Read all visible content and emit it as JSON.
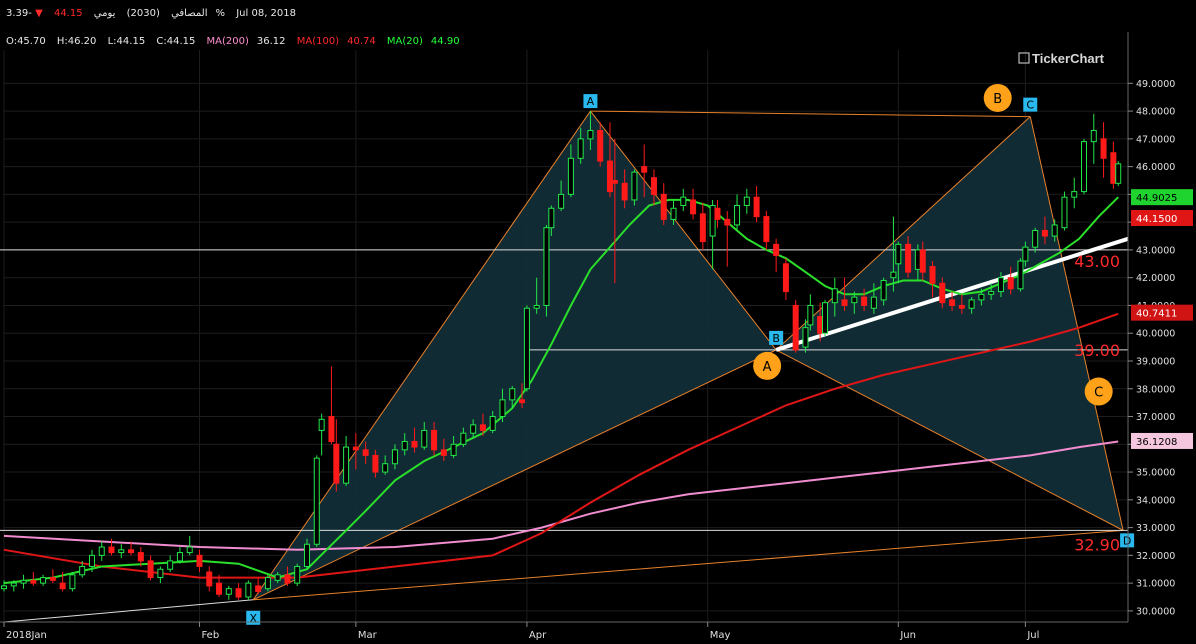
{
  "header": {
    "name": "المصافي",
    "code": "(2030)",
    "period": "يومي",
    "price": "44.15",
    "change": "-3.39%",
    "date": "Jul 08, 2018",
    "open": "O:45.70",
    "high": "H:46.20",
    "low": "L:44.15",
    "close": "C:44.15",
    "ma200_label": "MA(200)",
    "ma200_value": "36.12",
    "ma100_label": "MA(100)",
    "ma100_value": "40.74",
    "ma20_label": "MA(20)",
    "ma20_value": "44.90"
  },
  "watermark": "TickerChart",
  "colors": {
    "background": "#000000",
    "up": "#22e84a",
    "down": "#ff1a1a",
    "ma20": "#2adf2a",
    "ma100": "#e01616",
    "ma200": "#f08ccf",
    "pattern": "#e8802a",
    "pattern_fill": "#13303a",
    "trend_thick": "#ffffff",
    "label_blue": "#29b9ee",
    "label_orange": "#ffa21a",
    "target_red": "#ff2a2a"
  },
  "chart_data": {
    "type": "candlestick",
    "title": "المصافي (2030) يومي",
    "ylim": [
      29.6,
      50.2
    ],
    "y_ticks": [
      "49.0000",
      "48.0000",
      "47.0000",
      "46.0000",
      "45.0000",
      "44.0000",
      "43.0000",
      "42.0000",
      "41.0000",
      "40.0000",
      "39.0000",
      "38.0000",
      "37.0000",
      "36.0000",
      "35.0000",
      "34.0000",
      "33.0000",
      "32.0000",
      "31.0000",
      "30.0000"
    ],
    "x_ticks": [
      {
        "label": "2018Jan",
        "day": 0
      },
      {
        "label": "Feb",
        "day": 40
      },
      {
        "label": "Mar",
        "day": 72
      },
      {
        "label": "Apr",
        "day": 107
      },
      {
        "label": "May",
        "day": 144
      },
      {
        "label": "Jun",
        "day": 183
      },
      {
        "label": "Jul",
        "day": 209
      }
    ],
    "x_range": [
      0,
      230
    ],
    "candles": [
      [
        0,
        30.8,
        31.1,
        30.9,
        30.7
      ],
      [
        2,
        30.9,
        31.1,
        31.0,
        30.7
      ],
      [
        4,
        31.0,
        31.3,
        31.1,
        30.8
      ],
      [
        6,
        31.1,
        31.4,
        31.0,
        30.9
      ],
      [
        8,
        31.0,
        31.3,
        31.2,
        30.9
      ],
      [
        10,
        31.2,
        31.5,
        31.1,
        31.0
      ],
      [
        12,
        31.0,
        31.4,
        30.8,
        30.7
      ],
      [
        14,
        30.8,
        31.4,
        31.3,
        30.7
      ],
      [
        16,
        31.3,
        31.8,
        31.6,
        31.2
      ],
      [
        18,
        31.6,
        32.2,
        32.0,
        31.4
      ],
      [
        20,
        32.0,
        32.5,
        32.3,
        31.8
      ],
      [
        22,
        32.3,
        32.6,
        32.1,
        32.0
      ],
      [
        24,
        32.1,
        32.4,
        32.2,
        31.9
      ],
      [
        26,
        32.2,
        32.5,
        32.1,
        32.0
      ],
      [
        28,
        32.1,
        32.3,
        31.8,
        31.6
      ],
      [
        30,
        31.8,
        32.0,
        31.2,
        31.1
      ],
      [
        32,
        31.2,
        31.6,
        31.5,
        31.0
      ],
      [
        34,
        31.5,
        32.0,
        31.8,
        31.4
      ],
      [
        36,
        31.8,
        32.3,
        32.1,
        31.7
      ],
      [
        38,
        32.1,
        32.7,
        32.3,
        32.0
      ],
      [
        40,
        32.0,
        32.2,
        31.6,
        31.4
      ],
      [
        42,
        31.4,
        31.6,
        30.9,
        30.7
      ],
      [
        44,
        31.0,
        31.3,
        30.6,
        30.5
      ],
      [
        46,
        30.6,
        30.9,
        30.8,
        30.4
      ],
      [
        48,
        30.8,
        31.0,
        30.5,
        30.4
      ],
      [
        50,
        30.5,
        31.1,
        31.0,
        30.4
      ],
      [
        52,
        30.9,
        31.2,
        30.7,
        30.6
      ],
      [
        54,
        30.8,
        31.3,
        31.2,
        30.7
      ],
      [
        56,
        31.1,
        31.4,
        31.3,
        31.0
      ],
      [
        58,
        31.3,
        31.6,
        31.0,
        30.9
      ],
      [
        60,
        31.0,
        31.7,
        31.6,
        30.9
      ],
      [
        62,
        31.6,
        32.6,
        32.4,
        31.5
      ],
      [
        64,
        32.4,
        35.6,
        35.5,
        32.3
      ],
      [
        65,
        36.5,
        37.1,
        36.9,
        35.6
      ],
      [
        67,
        37.0,
        38.8,
        36.1,
        36.0
      ],
      [
        68,
        36.0,
        36.9,
        34.6,
        34.3
      ],
      [
        70,
        34.6,
        36.3,
        35.9,
        34.5
      ],
      [
        72,
        35.9,
        36.4,
        35.8,
        35.1
      ],
      [
        74,
        35.8,
        36.1,
        35.6,
        35.3
      ],
      [
        76,
        35.6,
        35.8,
        35.0,
        34.8
      ],
      [
        78,
        35.0,
        35.6,
        35.3,
        34.9
      ],
      [
        80,
        35.3,
        36.0,
        35.8,
        35.1
      ],
      [
        82,
        35.8,
        36.4,
        36.1,
        35.6
      ],
      [
        84,
        36.1,
        36.6,
        35.9,
        35.7
      ],
      [
        86,
        35.9,
        36.8,
        36.5,
        35.8
      ],
      [
        88,
        36.5,
        36.8,
        35.8,
        35.6
      ],
      [
        90,
        35.8,
        36.2,
        35.6,
        35.4
      ],
      [
        92,
        35.6,
        36.3,
        36.0,
        35.5
      ],
      [
        94,
        36.0,
        36.6,
        36.4,
        35.9
      ],
      [
        96,
        36.4,
        36.9,
        36.7,
        36.2
      ],
      [
        98,
        36.7,
        37.1,
        36.5,
        36.3
      ],
      [
        100,
        36.5,
        37.2,
        37.0,
        36.4
      ],
      [
        102,
        37.0,
        38.0,
        37.6,
        36.8
      ],
      [
        104,
        37.6,
        38.1,
        38.0,
        37.3
      ],
      [
        106,
        37.6,
        38.2,
        37.5,
        37.3
      ],
      [
        107,
        38.0,
        41.0,
        40.9,
        37.9
      ],
      [
        109,
        40.9,
        42.0,
        41.0,
        40.7
      ],
      [
        111,
        41.0,
        43.9,
        43.8,
        40.6
      ],
      [
        112,
        43.8,
        44.6,
        44.5,
        43.5
      ],
      [
        114,
        44.5,
        45.5,
        45.0,
        44.4
      ],
      [
        116,
        45.0,
        46.8,
        46.3,
        44.9
      ],
      [
        118,
        46.3,
        47.4,
        47.0,
        46.1
      ],
      [
        120,
        47.0,
        48.0,
        47.3,
        46.6
      ],
      [
        122,
        47.3,
        47.6,
        46.2,
        46.0
      ],
      [
        124,
        46.2,
        47.6,
        45.1,
        44.9
      ],
      [
        125,
        45.5,
        47.0,
        45.4,
        41.8
      ],
      [
        127,
        45.4,
        45.9,
        44.8,
        44.5
      ],
      [
        129,
        44.8,
        45.9,
        45.8,
        44.6
      ],
      [
        131,
        46.0,
        46.8,
        45.8,
        44.9
      ],
      [
        133,
        45.6,
        45.9,
        45.0,
        44.6
      ],
      [
        135,
        45.0,
        45.4,
        44.1,
        43.9
      ],
      [
        137,
        44.1,
        44.8,
        44.5,
        43.9
      ],
      [
        139,
        44.6,
        45.2,
        44.9,
        44.4
      ],
      [
        141,
        44.8,
        45.2,
        44.3,
        44.1
      ],
      [
        143,
        44.3,
        44.7,
        43.3,
        43.0
      ],
      [
        145,
        43.5,
        44.8,
        44.6,
        42.3
      ],
      [
        146,
        44.5,
        44.8,
        44.1,
        43.8
      ],
      [
        148,
        44.1,
        44.4,
        43.9,
        42.4
      ],
      [
        150,
        43.9,
        45.0,
        44.6,
        43.7
      ],
      [
        152,
        44.6,
        45.2,
        44.9,
        44.3
      ],
      [
        154,
        44.9,
        45.3,
        44.2,
        44.0
      ],
      [
        156,
        44.2,
        44.4,
        43.3,
        43.0
      ],
      [
        158,
        43.2,
        43.4,
        42.8,
        42.2
      ],
      [
        160,
        42.5,
        42.7,
        41.5,
        41.2
      ],
      [
        162,
        41.0,
        41.2,
        39.4,
        39.3
      ],
      [
        164,
        39.5,
        40.5,
        40.2,
        39.3
      ],
      [
        165,
        40.3,
        41.4,
        41.0,
        40.1
      ],
      [
        167,
        40.6,
        41.1,
        40.0,
        39.7
      ],
      [
        168,
        40.0,
        41.2,
        41.1,
        39.9
      ],
      [
        170,
        41.1,
        42.0,
        41.6,
        40.6
      ],
      [
        172,
        41.2,
        42.0,
        41.0,
        40.8
      ],
      [
        174,
        41.1,
        41.5,
        41.3,
        40.7
      ],
      [
        176,
        41.3,
        41.6,
        41.0,
        40.8
      ],
      [
        178,
        40.9,
        41.8,
        41.3,
        40.7
      ],
      [
        180,
        41.2,
        42.0,
        41.9,
        41.0
      ],
      [
        182,
        42.0,
        44.2,
        42.2,
        41.5
      ],
      [
        183,
        42.5,
        43.3,
        43.2,
        41.8
      ],
      [
        185,
        43.2,
        43.5,
        42.2,
        42.0
      ],
      [
        187,
        42.3,
        43.2,
        43.0,
        41.9
      ],
      [
        188,
        43.0,
        43.3,
        42.2,
        41.9
      ],
      [
        190,
        42.4,
        42.6,
        41.8,
        41.3
      ],
      [
        192,
        41.8,
        42.0,
        41.1,
        40.9
      ],
      [
        194,
        41.2,
        41.5,
        41.0,
        40.8
      ],
      [
        196,
        41.0,
        41.4,
        40.9,
        40.7
      ],
      [
        198,
        40.9,
        41.3,
        41.2,
        40.7
      ],
      [
        200,
        41.2,
        41.6,
        41.4,
        41.0
      ],
      [
        202,
        41.4,
        41.8,
        41.5,
        41.2
      ],
      [
        204,
        41.5,
        42.2,
        42.0,
        41.3
      ],
      [
        206,
        42.0,
        42.4,
        41.6,
        41.4
      ],
      [
        208,
        41.6,
        42.7,
        42.6,
        41.5
      ],
      [
        209,
        42.6,
        43.3,
        43.1,
        42.4
      ],
      [
        211,
        43.1,
        43.8,
        43.7,
        42.9
      ],
      [
        213,
        43.7,
        44.2,
        43.5,
        43.2
      ],
      [
        215,
        43.5,
        44.1,
        43.9,
        43.3
      ],
      [
        217,
        43.8,
        45.1,
        44.9,
        43.7
      ],
      [
        219,
        44.9,
        45.6,
        45.1,
        44.5
      ],
      [
        221,
        45.1,
        47.0,
        46.9,
        45.0
      ],
      [
        223,
        46.9,
        47.9,
        47.3,
        46.1
      ],
      [
        225,
        47.0,
        47.6,
        46.3,
        45.6
      ],
      [
        227,
        46.5,
        46.9,
        45.4,
        45.2
      ],
      [
        228,
        45.4,
        46.2,
        46.1,
        45.3
      ]
    ],
    "ma20": [
      [
        0,
        31.0
      ],
      [
        10,
        31.2
      ],
      [
        20,
        31.6
      ],
      [
        30,
        31.7
      ],
      [
        40,
        31.8
      ],
      [
        48,
        31.7
      ],
      [
        56,
        31.2
      ],
      [
        62,
        31.5
      ],
      [
        66,
        32.2
      ],
      [
        70,
        32.9
      ],
      [
        74,
        33.6
      ],
      [
        80,
        34.7
      ],
      [
        86,
        35.4
      ],
      [
        92,
        35.9
      ],
      [
        98,
        36.4
      ],
      [
        104,
        37.3
      ],
      [
        108,
        38.3
      ],
      [
        112,
        39.6
      ],
      [
        116,
        41.0
      ],
      [
        120,
        42.3
      ],
      [
        124,
        43.1
      ],
      [
        128,
        43.9
      ],
      [
        132,
        44.6
      ],
      [
        136,
        44.8
      ],
      [
        140,
        44.8
      ],
      [
        144,
        44.6
      ],
      [
        148,
        44.0
      ],
      [
        152,
        43.4
      ],
      [
        156,
        43.0
      ],
      [
        160,
        42.7
      ],
      [
        164,
        42.2
      ],
      [
        168,
        41.7
      ],
      [
        172,
        41.4
      ],
      [
        176,
        41.4
      ],
      [
        180,
        41.7
      ],
      [
        184,
        41.9
      ],
      [
        188,
        41.9
      ],
      [
        192,
        41.6
      ],
      [
        196,
        41.4
      ],
      [
        200,
        41.5
      ],
      [
        204,
        41.8
      ],
      [
        208,
        42.1
      ],
      [
        212,
        42.5
      ],
      [
        216,
        42.9
      ],
      [
        220,
        43.4
      ],
      [
        224,
        44.2
      ],
      [
        228,
        44.9
      ]
    ],
    "ma100": [
      [
        0,
        32.2
      ],
      [
        20,
        31.6
      ],
      [
        40,
        31.2
      ],
      [
        60,
        31.2
      ],
      [
        80,
        31.6
      ],
      [
        100,
        32.0
      ],
      [
        110,
        32.8
      ],
      [
        120,
        33.9
      ],
      [
        130,
        34.9
      ],
      [
        140,
        35.8
      ],
      [
        150,
        36.6
      ],
      [
        160,
        37.4
      ],
      [
        170,
        38.0
      ],
      [
        180,
        38.5
      ],
      [
        190,
        38.9
      ],
      [
        200,
        39.3
      ],
      [
        210,
        39.7
      ],
      [
        220,
        40.2
      ],
      [
        228,
        40.7
      ]
    ],
    "ma200": [
      [
        0,
        32.7
      ],
      [
        20,
        32.5
      ],
      [
        40,
        32.3
      ],
      [
        60,
        32.2
      ],
      [
        80,
        32.3
      ],
      [
        100,
        32.6
      ],
      [
        110,
        33.0
      ],
      [
        120,
        33.5
      ],
      [
        130,
        33.9
      ],
      [
        140,
        34.2
      ],
      [
        150,
        34.4
      ],
      [
        160,
        34.6
      ],
      [
        170,
        34.8
      ],
      [
        180,
        35.0
      ],
      [
        190,
        35.2
      ],
      [
        200,
        35.4
      ],
      [
        210,
        35.6
      ],
      [
        220,
        35.9
      ],
      [
        228,
        36.1
      ]
    ],
    "pattern_points": [
      {
        "label": "X",
        "day": 51,
        "value": 30.4
      },
      {
        "label": "A",
        "day": 120,
        "value": 48.0
      },
      {
        "label": "B",
        "day": 158,
        "value": 39.4
      },
      {
        "label": "C",
        "day": 210,
        "value": 47.8
      },
      {
        "label": "D",
        "day": 229,
        "value": 32.9
      }
    ],
    "second_pattern_labels": [
      {
        "label": "A",
        "day": 158,
        "value": 39.4
      },
      {
        "label": "B",
        "day": 206,
        "value": 48.4
      },
      {
        "label": "C",
        "day": 224,
        "value": 37.9
      }
    ],
    "horizontal_lines": [
      43.0,
      39.4,
      32.9,
      48.0
    ],
    "target_labels": [
      {
        "text": "43.00",
        "value": 42.6
      },
      {
        "text": "39.00",
        "value": 39.4
      },
      {
        "text": "32.90",
        "value": 32.4
      }
    ],
    "price_tags": [
      {
        "text": "44.9025",
        "value": 44.9,
        "color": "#1fd42f",
        "text_color": "#000"
      },
      {
        "text": "44.1500",
        "value": 44.15,
        "color": "#e01616",
        "text_color": "#fff"
      },
      {
        "text": "40.7411",
        "value": 40.74,
        "color": "#d01414",
        "text_color": "#fff"
      },
      {
        "text": "36.1208",
        "value": 36.12,
        "color": "#f5c6de",
        "text_color": "#000"
      }
    ]
  }
}
